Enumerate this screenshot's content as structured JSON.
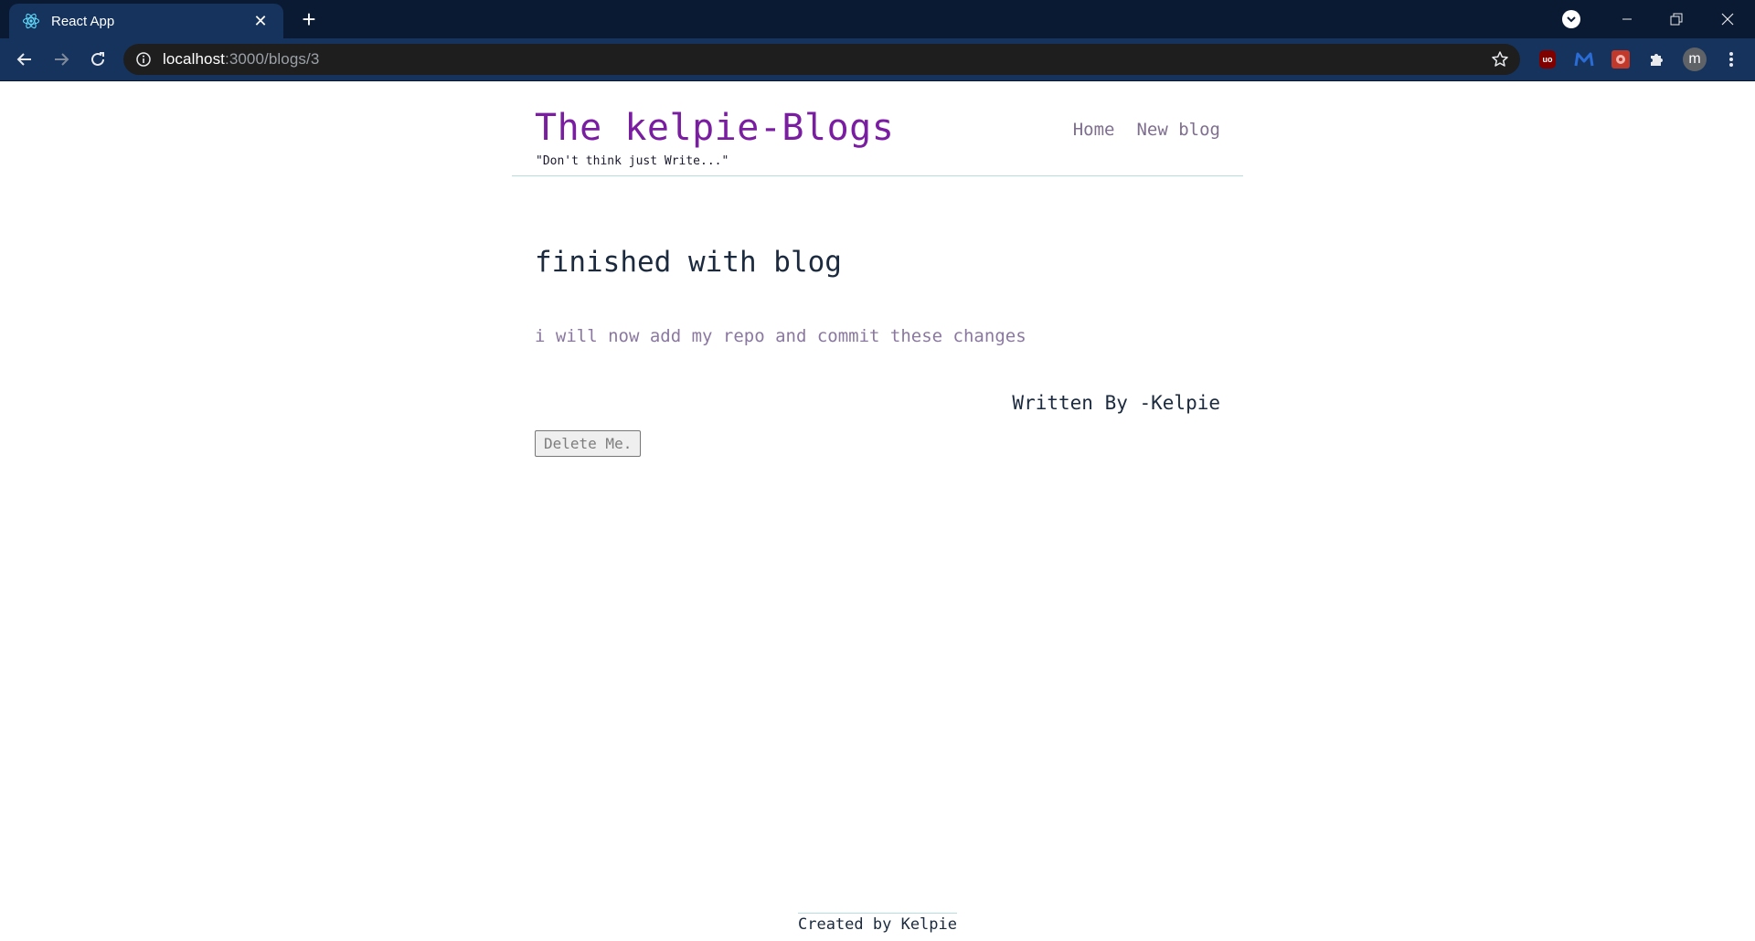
{
  "browser": {
    "tab": {
      "title": "React App"
    },
    "url": {
      "host": "localhost",
      "path": ":3000/blogs/3"
    },
    "profile_initial": "m",
    "extensions": [
      "ublock-origin-icon",
      "malwarebytes-icon",
      "red-extension-icon",
      "puzzle-extensions-icon"
    ]
  },
  "site": {
    "brand": "The kelpie-Blogs",
    "tagline": "\"Don't think just Write...\"",
    "nav": {
      "home": "Home",
      "new_blog": "New blog"
    }
  },
  "post": {
    "title": "finished with blog",
    "body": "i will now add my repo and commit these changes",
    "author": "Written By -Kelpie",
    "delete_label": "Delete Me."
  },
  "footer": {
    "text": "Created by Kelpie"
  },
  "colors": {
    "brand": "#7a1ea1",
    "chrome_dark": "#0b1a33",
    "chrome_toolbar": "#15335c",
    "divider": "#b7dbe0"
  }
}
